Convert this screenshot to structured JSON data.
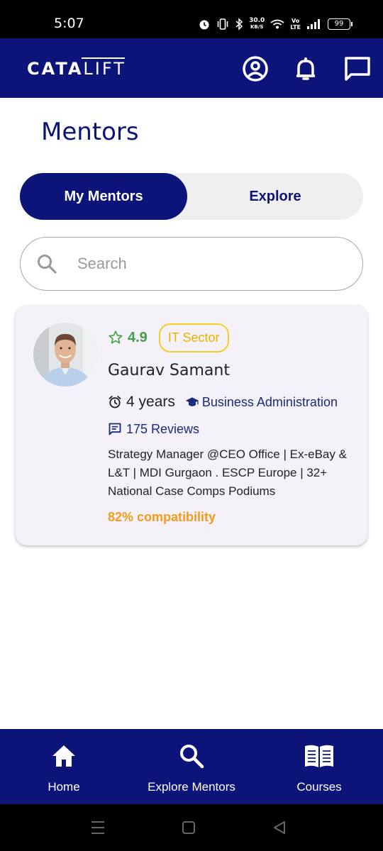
{
  "status_bar": {
    "time": "5:07",
    "net_speed_value": "30.0",
    "net_speed_unit": "KB/S",
    "volte": "Vo\nLTE",
    "battery": "99"
  },
  "header": {
    "logo_main": "CATA",
    "logo_accent": "LIFT",
    "icons": [
      "profile-icon",
      "notification-bell-icon",
      "chat-icon"
    ]
  },
  "page": {
    "title": "Mentors"
  },
  "toggle": {
    "active_label": "My Mentors",
    "inactive_label": "Explore"
  },
  "search": {
    "placeholder": "Search",
    "value": ""
  },
  "mentor": {
    "rating": "4.9",
    "sector": "IT Sector",
    "name": "Gaurav Samant",
    "experience": "4 years",
    "degree": "Business Administration",
    "reviews": "175 Reviews",
    "bio": "Strategy Manager @CEO Office | Ex-eBay & L&T | MDI Gurgaon . ESCP Europe | 32+ National Case Comps Podiums",
    "compatibility": "82% compatibility"
  },
  "bottom_nav": {
    "items": [
      {
        "label": "Home",
        "icon": "home-icon"
      },
      {
        "label": "Explore Mentors",
        "icon": "search-icon"
      },
      {
        "label": "Courses",
        "icon": "book-icon"
      }
    ]
  },
  "colors": {
    "brand": "#0c1479",
    "rating": "#43a047",
    "badge": "#f3cc28",
    "compatibility": "#f49a1a",
    "card_bg": "#f5f1f9"
  }
}
